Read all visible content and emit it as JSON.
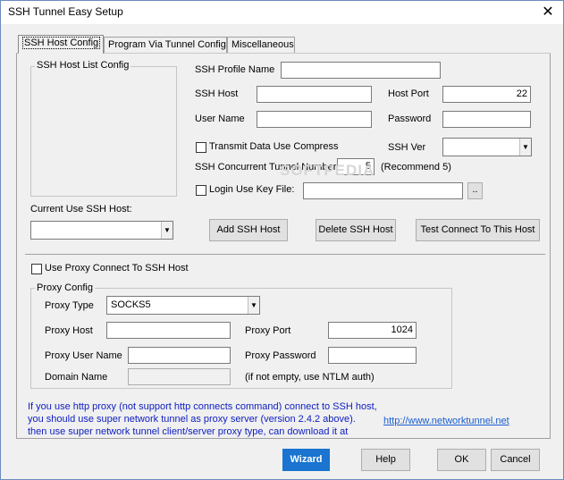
{
  "window": {
    "title": "SSH Tunnel Easy Setup",
    "close_glyph": "✕"
  },
  "tabs": [
    {
      "label": "SSH  Host Config"
    },
    {
      "label": "Program Via Tunnel Config"
    },
    {
      "label": "Miscellaneous"
    }
  ],
  "host_list": {
    "label": "SSH Host List Config"
  },
  "profile": {
    "name_label": "SSH Profile Name",
    "name_value": "",
    "host_label": "SSH Host",
    "host_value": "",
    "port_label": "Host Port",
    "port_value": "22",
    "user_label": "User Name",
    "user_value": "",
    "password_label": "Password",
    "password_value": "",
    "compress_label": "Transmit Data Use Compress",
    "ver_label": "SSH Ver",
    "ver_value": "",
    "concurrent_label": "SSH Concurrent Tunnel Number:",
    "concurrent_value": "5",
    "recommend_text": "(Recommend 5)",
    "keyfile_label": "Login Use Key File:",
    "keyfile_value": "",
    "browse_label": ".."
  },
  "current_host": {
    "label": "Current Use SSH Host:",
    "value": ""
  },
  "actions": {
    "add": "Add  SSH Host",
    "delete": "Delete SSH Host",
    "test": "Test Connect To This Host"
  },
  "proxy": {
    "use_label": "Use Proxy Connect To SSH Host",
    "group_label": "Proxy Config",
    "type_label": "Proxy Type",
    "type_value": "SOCKS5",
    "host_label": "Proxy Host",
    "host_value": "",
    "port_label": "Proxy Port",
    "port_value": "1024",
    "user_label": "Proxy User Name",
    "user_value": "",
    "password_label": "Proxy Password",
    "password_value": "",
    "domain_label": "Domain Name",
    "domain_value": "",
    "ntlm_note": "(if not empty, use NTLM auth)"
  },
  "info": {
    "line1": "If you use http proxy (not support http connects command) connect to SSH host,",
    "line2": "you should use super network tunnel as proxy server (version 2.4.2 above).",
    "line3": "then use super network tunnel client/server proxy type, can download it at",
    "link": "http://www.networktunnel.net"
  },
  "footer": {
    "wizard": "Wizard",
    "help": "Help",
    "ok": "OK",
    "cancel": "Cancel"
  },
  "watermark": "SOFTPEDIA"
}
